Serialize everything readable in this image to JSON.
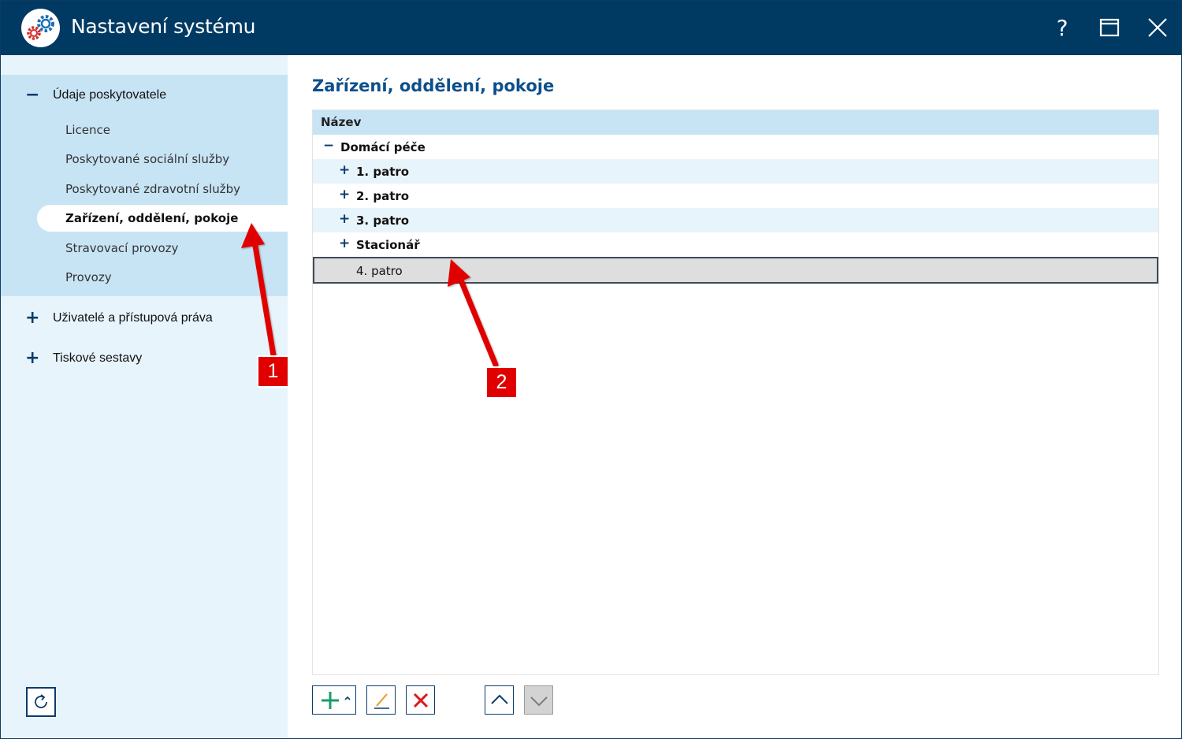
{
  "window": {
    "title": "Nastavení systému",
    "help_label": "?"
  },
  "sidebar": {
    "groups": [
      {
        "label": "Údaje poskytovatele",
        "expanded": true,
        "items": [
          {
            "label": "Licence"
          },
          {
            "label": "Poskytované sociální služby"
          },
          {
            "label": "Poskytované zdravotní služby"
          },
          {
            "label": "Zařízení, oddělení, pokoje",
            "active": true
          },
          {
            "label": "Stravovací provozy"
          },
          {
            "label": "Provozy"
          }
        ]
      },
      {
        "label": "Uživatelé a přístupová práva",
        "expanded": false
      },
      {
        "label": "Tiskové sestavy",
        "expanded": false
      }
    ],
    "refresh_icon": "refresh-icon"
  },
  "main": {
    "title": "Zařízení, oddělení, pokoje",
    "grid": {
      "column_header": "Název",
      "rows": [
        {
          "label": "Domácí péče",
          "level": 0,
          "toggle": "−",
          "bold": true
        },
        {
          "label": "1. patro",
          "level": 1,
          "toggle": "+",
          "bold": true
        },
        {
          "label": "2. patro",
          "level": 1,
          "toggle": "+",
          "bold": true
        },
        {
          "label": "3. patro",
          "level": 1,
          "toggle": "+",
          "bold": true
        },
        {
          "label": "Stacionář",
          "level": 1,
          "toggle": "+",
          "bold": true
        },
        {
          "label": "4. patro",
          "level": 1,
          "toggle": "",
          "bold": false,
          "selected": true
        }
      ]
    },
    "toolbar": {
      "buttons": [
        "add-icon",
        "edit-icon",
        "delete-icon",
        "move-up-icon",
        "move-down-icon"
      ]
    }
  },
  "annotations": {
    "callout_1": "1",
    "callout_2": "2"
  },
  "colors": {
    "titlebar": "#003a63",
    "sidebar_bg": "#e8f4fb",
    "sidebar_group_bg": "#c7e4f5",
    "heading": "#0d4f8b",
    "callout": "#e10000",
    "add_green": "#1a9c6a",
    "delete_red": "#d81b1b"
  }
}
